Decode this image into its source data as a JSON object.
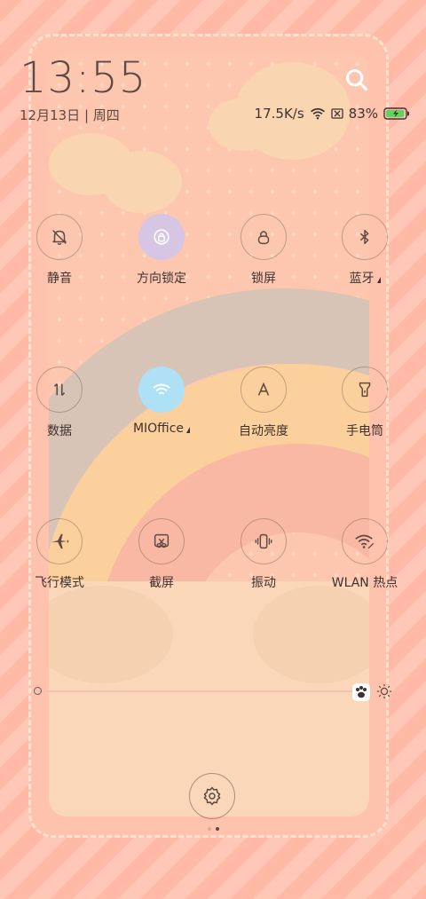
{
  "status": {
    "time": "13:55",
    "date": "12月13日 | 周四",
    "net_speed": "17.5K/s",
    "battery": "83%"
  },
  "toggles": [
    {
      "label": "静音",
      "icon": "bell-off-icon",
      "active": false
    },
    {
      "label": "方向锁定",
      "icon": "rotation-lock-icon",
      "active": true
    },
    {
      "label": "锁屏",
      "icon": "lock-icon",
      "active": false
    },
    {
      "label": "蓝牙",
      "icon": "bluetooth-icon",
      "active": false
    },
    {
      "label": "数据",
      "icon": "mobile-data-icon",
      "active": false
    },
    {
      "label": "MIOffice",
      "icon": "wifi-icon",
      "active": true
    },
    {
      "label": "自动亮度",
      "icon": "auto-brightness-icon",
      "active": false
    },
    {
      "label": "手电筒",
      "icon": "flashlight-icon",
      "active": false
    },
    {
      "label": "飞行模式",
      "icon": "airplane-icon",
      "active": false
    },
    {
      "label": "截屏",
      "icon": "screenshot-icon",
      "active": false
    },
    {
      "label": "振动",
      "icon": "vibrate-icon",
      "active": false
    },
    {
      "label": "WLAN 热点",
      "icon": "hotspot-icon",
      "active": false
    }
  ],
  "brightness": {
    "level": 0
  },
  "pager": {
    "pages": 2,
    "current": 2
  }
}
